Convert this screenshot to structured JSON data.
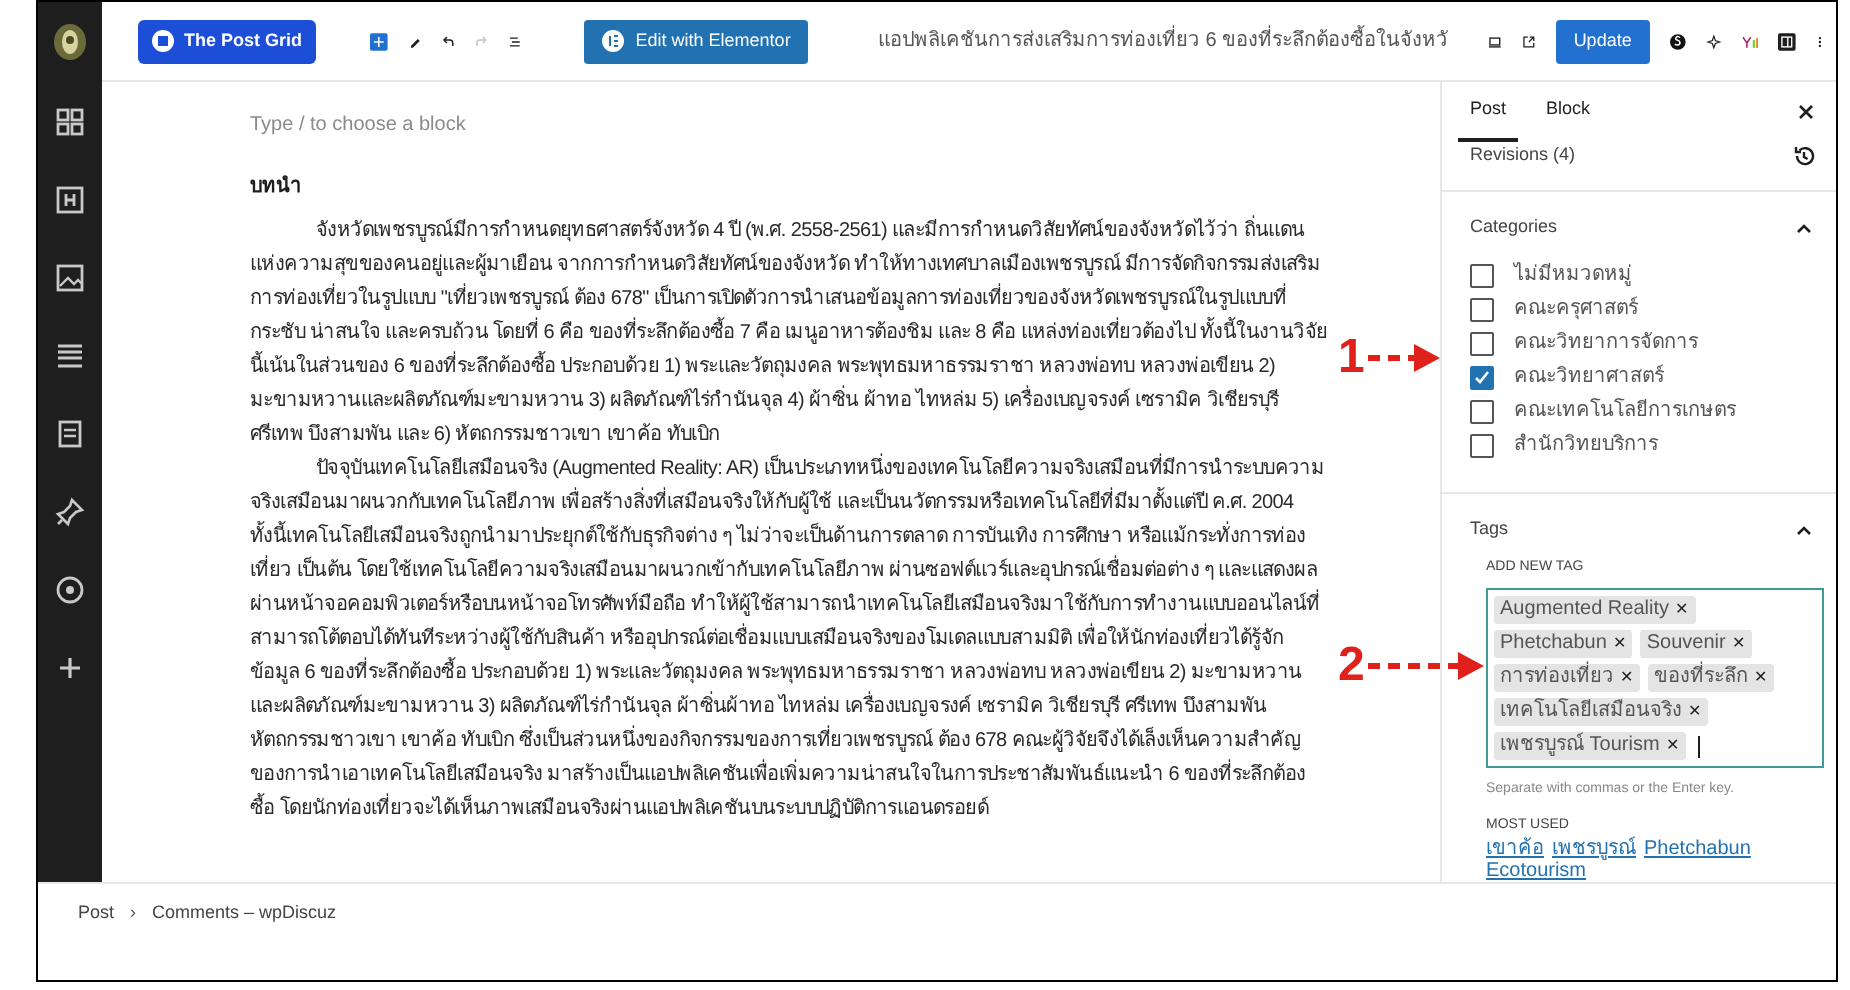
{
  "toolbar": {
    "post_grid_button": "The Post Grid",
    "elementor_button": "Edit with Elementor",
    "document_title": "แอปพลิเคชันการส่งเสริมการท่องเที่ยว 6 ของที่ระลึกต้องซื้อในจังหวั",
    "update_button": "Update",
    "undo_disabled": false,
    "redo_disabled": true
  },
  "editor": {
    "placeholder": "Type / to choose a block",
    "heading": "บทนำ",
    "paragraphs": [
      "จังหวัดเพชรบูรณ์มีการกำหนดยุทธศาสตร์จังหวัด 4 ปี (พ.ศ. 2558-2561) และมีการกำหนดวิสัยทัศน์ของจังหวัดไว้ว่า ถิ่นแดนแห่งความสุขของคนอยู่และผู้มาเยือน จากการกำหนดวิสัยทัศน์ของจังหวัด ทำให้ทางเทศบาลเมืองเพชรบูรณ์ มีการจัดกิจกรรมส่งเสริมการท่องเที่ยวในรูปแบบ \"เที่ยวเพชรบูรณ์ ต้อง 678\" เป็นการเปิดตัวการนำเสนอข้อมูลการท่องเที่ยวของจังหวัดเพชรบูรณ์ในรูปแบบที่กระชับ น่าสนใจ และครบถ้วน โดยที่ 6 คือ ของที่ระลึกต้องซื้อ 7 คือ เมนูอาหารต้องชิม และ 8 คือ แหล่งท่องเที่ยวต้องไป ทั้งนี้ในงานวิจัยนี้เน้นในส่วนของ 6 ของที่ระลึกต้องซื้อ ประกอบด้วย 1) พระและวัตถุมงคล พระพุทธมหาธรรมราชา หลวงพ่อทบ หลวงพ่อเขียน 2) มะขามหวานและผลิตภัณฑ์มะขามหวาน 3) ผลิตภัณฑ์ไร่กำนันจุล 4) ผ้าซิ่น ผ้าทอ ไทหล่ม 5) เครื่องเบญจรงค์ เซรามิค วิเชียรบุรี ศรีเทพ บึงสามพัน และ 6) หัตถกรรมชาวเขา เขาค้อ ทับเบิก",
      "ปัจจุบันเทคโนโลยีเสมือนจริง (Augmented Reality: AR) เป็นประเภทหนึ่งของเทคโนโลยีความจริงเสมือนที่มีการนำระบบความจริงเสมือนมาผนวกกับเทคโนโลยีภาพ เพื่อสร้างสิ่งที่เสมือนจริงให้กับผู้ใช้ และเป็นนวัตกรรมหรือเทคโนโลยีที่มีมาตั้งแต่ปี ค.ศ. 2004 ทั้งนี้เทคโนโลยีเสมือนจริงถูกนำมาประยุกต์ใช้กับธุรกิจต่าง ๆ ไม่ว่าจะเป็นด้านการตลาด การบันเทิง การศึกษา หรือแม้กระทั่งการท่องเที่ยว เป็นต้น โดยใช้เทคโนโลยีความจริงเสมือนมาผนวกเข้ากับเทคโนโลยีภาพ ผ่านซอฟต์แวร์และอุปกรณ์เชื่อมต่อต่าง ๆ และแสดงผลผ่านหน้าจอคอมพิวเตอร์หรือบนหน้าจอโทรศัพท์มือถือ ทำให้ผู้ใช้สามารถนำเทคโนโลยีเสมือนจริงมาใช้กับการทำงานแบบออนไลน์ที่สามารถโต้ตอบได้ทันทีระหว่างผู้ใช้กับสินค้า หรืออุปกรณ์ต่อเชื่อมแบบเสมือนจริงของโมเดลแบบสามมิติ เพื่อให้นักท่องเที่ยวได้รู้จักข้อมูล 6 ของที่ระลึกต้องซื้อ ประกอบด้วย 1) พระและวัตถุมงคล พระพุทธมหาธรรมราชา หลวงพ่อทบ หลวงพ่อเขียน 2) มะขามหวานและผลิตภัณฑ์มะขามหวาน 3) ผลิตภัณฑ์ไร่กำนันจุล ผ้าซิ่นผ้าทอ ไทหล่ม เครื่องเบญจรงค์ เซรามิค วิเชียรบุรี ศรีเทพ บึงสามพัน หัตถกรรมชาวเขา เขาค้อ ทับเบิก ซึ่งเป็นส่วนหนึ่งของกิจกรรมของการเที่ยวเพชรบูรณ์ ต้อง 678 คณะผู้วิจัยจึงได้เล็งเห็นความสำคัญของการนำเอาเทคโนโลยีเสมือนจริง มาสร้างเป็นแอปพลิเคชันเพื่อเพิ่มความน่าสนใจในการประชาสัมพันธ์แนะนำ 6 ของที่ระลึกต้องซื้อ โดยนักท่องเที่ยวจะได้เห็นภาพเสมือนจริงผ่านแอปพลิเคชันบนระบบปฏิบัติการแอนดรอยด์"
    ]
  },
  "sidebar": {
    "tabs": [
      {
        "label": "Post",
        "selected": true
      },
      {
        "label": "Block",
        "selected": false
      }
    ],
    "revisions": "Revisions (4)",
    "categories": {
      "title": "Categories",
      "items": [
        {
          "label": "ไม่มีหมวดหมู่",
          "checked": false
        },
        {
          "label": "คณะครุศาสตร์",
          "checked": false
        },
        {
          "label": "คณะวิทยาการจัดการ",
          "checked": false
        },
        {
          "label": "คณะวิทยาศาสตร์",
          "checked": true
        },
        {
          "label": "คณะเทคโนโลยีการเกษตร",
          "checked": false
        },
        {
          "label": "สำนักวิทยบริการ",
          "checked": false
        }
      ]
    },
    "tags": {
      "title": "Tags",
      "add_label": "ADD NEW TAG",
      "tags": [
        "Augmented Reality",
        "Phetchabun",
        "Souvenir",
        "การท่องเที่ยว",
        "ของที่ระลึก",
        "เทคโนโลยีเสมือนจริง",
        "เพชรบูรณ์ Tourism"
      ],
      "remove_mark": "✕",
      "help": "Separate with commas or the Enter key.",
      "most_used_label": "MOST USED",
      "most_used": [
        "เขาค้อ",
        "เพชรบูรณ์",
        "Phetchabun",
        "Ecotourism"
      ]
    }
  },
  "annotations": [
    {
      "label": "1"
    },
    {
      "label": "2"
    }
  ],
  "breadcrumb": {
    "items": [
      "Post",
      "Comments – wpDiscuz"
    ],
    "separator": "›"
  }
}
